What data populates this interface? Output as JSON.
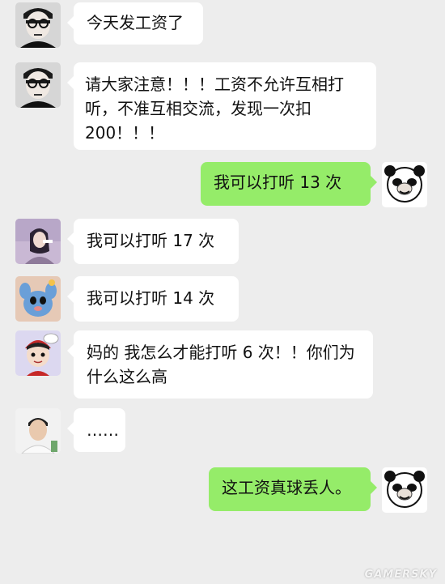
{
  "messages": [
    {
      "side": "in",
      "avatar": "man-with-glasses-avatar",
      "text": "今天发工资了"
    },
    {
      "side": "in",
      "avatar": "man-with-glasses-avatar",
      "text": "请大家注意！！！工资不允许互相打听，不准互相交流，发现一次扣200！！！"
    },
    {
      "side": "out",
      "avatar": "panda-meme-avatar",
      "text": "我可以打听 13 次"
    },
    {
      "side": "in",
      "avatar": "girl-avatar",
      "text": "我可以打听 17 次"
    },
    {
      "side": "in",
      "avatar": "blue-cartoon-avatar",
      "text": "我可以打听 14 次"
    },
    {
      "side": "in",
      "avatar": "cartoon-boy-avatar",
      "text": "妈的 我怎么才能打听 6 次！！你们为什么这么高"
    },
    {
      "side": "in",
      "avatar": "boy-photo-avatar",
      "text": "……"
    },
    {
      "side": "out",
      "avatar": "panda-meme-avatar",
      "text": "这工资真球丢人。"
    }
  ],
  "watermark": "GAMERSKY",
  "colors": {
    "background": "#ededed",
    "incoming_bubble": "#ffffff",
    "outgoing_bubble": "#95ec69"
  }
}
